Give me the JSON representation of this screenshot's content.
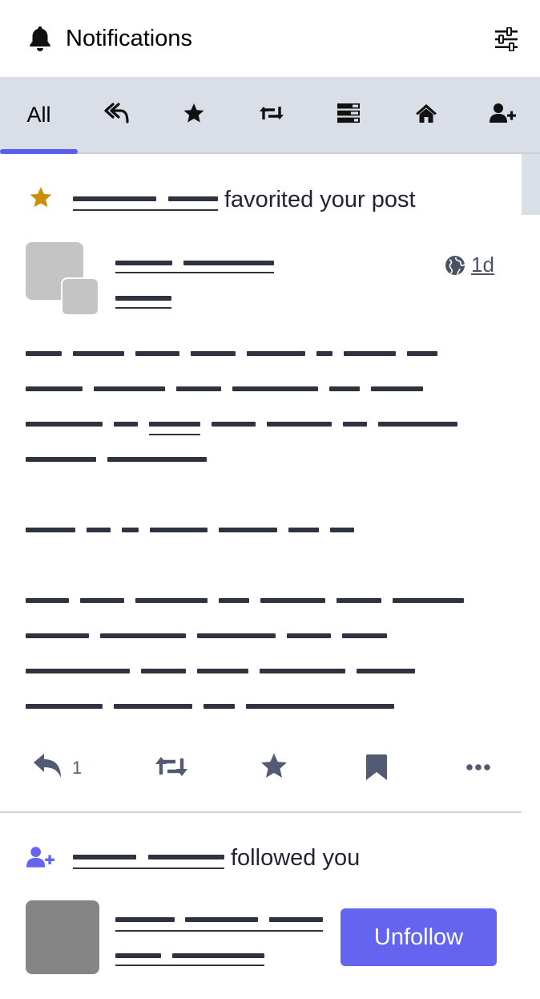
{
  "header": {
    "title": "Notifications",
    "bell_icon": "bell-icon",
    "settings_icon": "sliders-icon"
  },
  "tabs": [
    {
      "id": "all",
      "label": "All"
    },
    {
      "id": "mentions",
      "icon": "reply-all-icon"
    },
    {
      "id": "favourites",
      "icon": "star-icon"
    },
    {
      "id": "boosts",
      "icon": "retweet-icon"
    },
    {
      "id": "polls",
      "icon": "tasks-icon"
    },
    {
      "id": "statuses",
      "icon": "home-icon"
    },
    {
      "id": "follows",
      "icon": "user-plus-icon"
    }
  ],
  "notifications": [
    {
      "type": "favourite",
      "action_text": "favorited your post",
      "status": {
        "time": "1d",
        "visibility_icon": "globe-icon",
        "actions": {
          "reply_count": "1"
        }
      }
    },
    {
      "type": "follow",
      "action_text": "followed you",
      "button_label": "Unfollow"
    }
  ],
  "colors": {
    "accent": "#6364f0",
    "tab_bar": "#d9dee7",
    "star": "#ca8f04",
    "icon": "#535a73",
    "redacted_text": "#2f3340"
  }
}
